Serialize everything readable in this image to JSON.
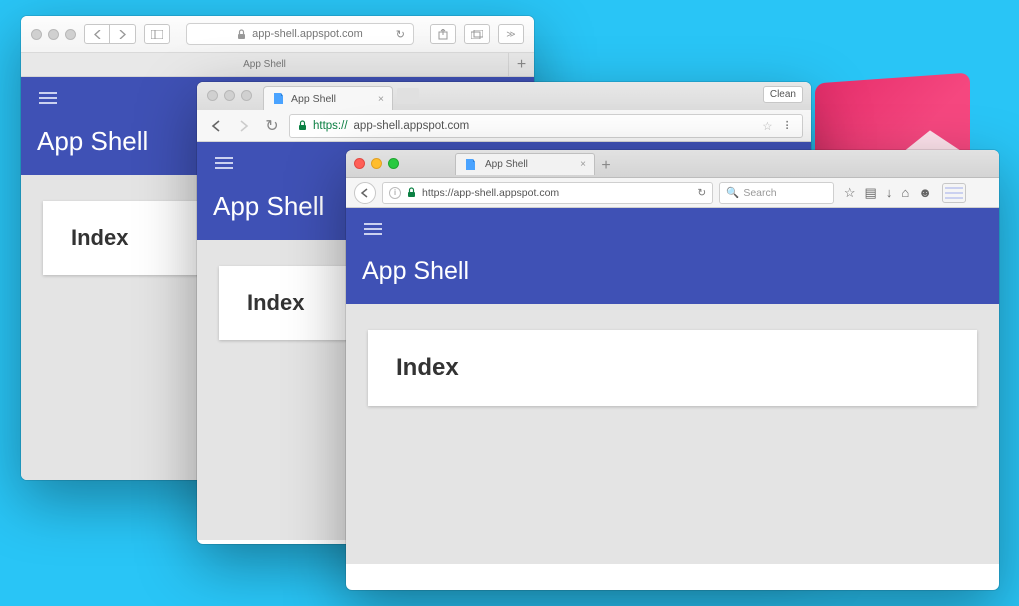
{
  "app": {
    "title": "App Shell",
    "card_heading": "Index"
  },
  "safari": {
    "address": "app-shell.appspot.com",
    "tab_title": "App Shell"
  },
  "chrome": {
    "tab_title": "App Shell",
    "url_scheme": "https://",
    "url_rest": "app-shell.appspot.com",
    "clean_label": "Clean"
  },
  "firefox": {
    "tab_title": "App Shell",
    "url": "https://app-shell.appspot.com",
    "search_placeholder": "Search"
  }
}
